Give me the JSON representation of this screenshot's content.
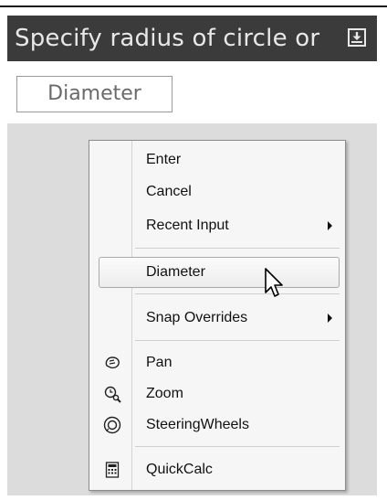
{
  "prompt": {
    "text": "Specify radius of circle or",
    "icon": "download-arrow-icon"
  },
  "option_button": {
    "label": "Diameter"
  },
  "context_menu": {
    "items": [
      {
        "label": "Enter"
      },
      {
        "label": "Cancel"
      },
      {
        "label": "Recent Input",
        "submenu": true
      },
      {
        "label": "Diameter",
        "highlighted": true
      },
      {
        "label": "Snap Overrides",
        "submenu": true
      },
      {
        "label": "Pan",
        "icon": "pan-hand-icon"
      },
      {
        "label": "Zoom",
        "icon": "zoom-magnifier-icon"
      },
      {
        "label": "SteeringWheels",
        "icon": "steering-wheel-icon"
      },
      {
        "label": "QuickCalc",
        "icon": "calculator-icon"
      }
    ]
  },
  "colors": {
    "prompt_bg": "#3b3b3b",
    "prompt_text": "#e8e8e8",
    "panel_bg": "#dcdcdc",
    "menu_bg": "#f6f6f6"
  }
}
